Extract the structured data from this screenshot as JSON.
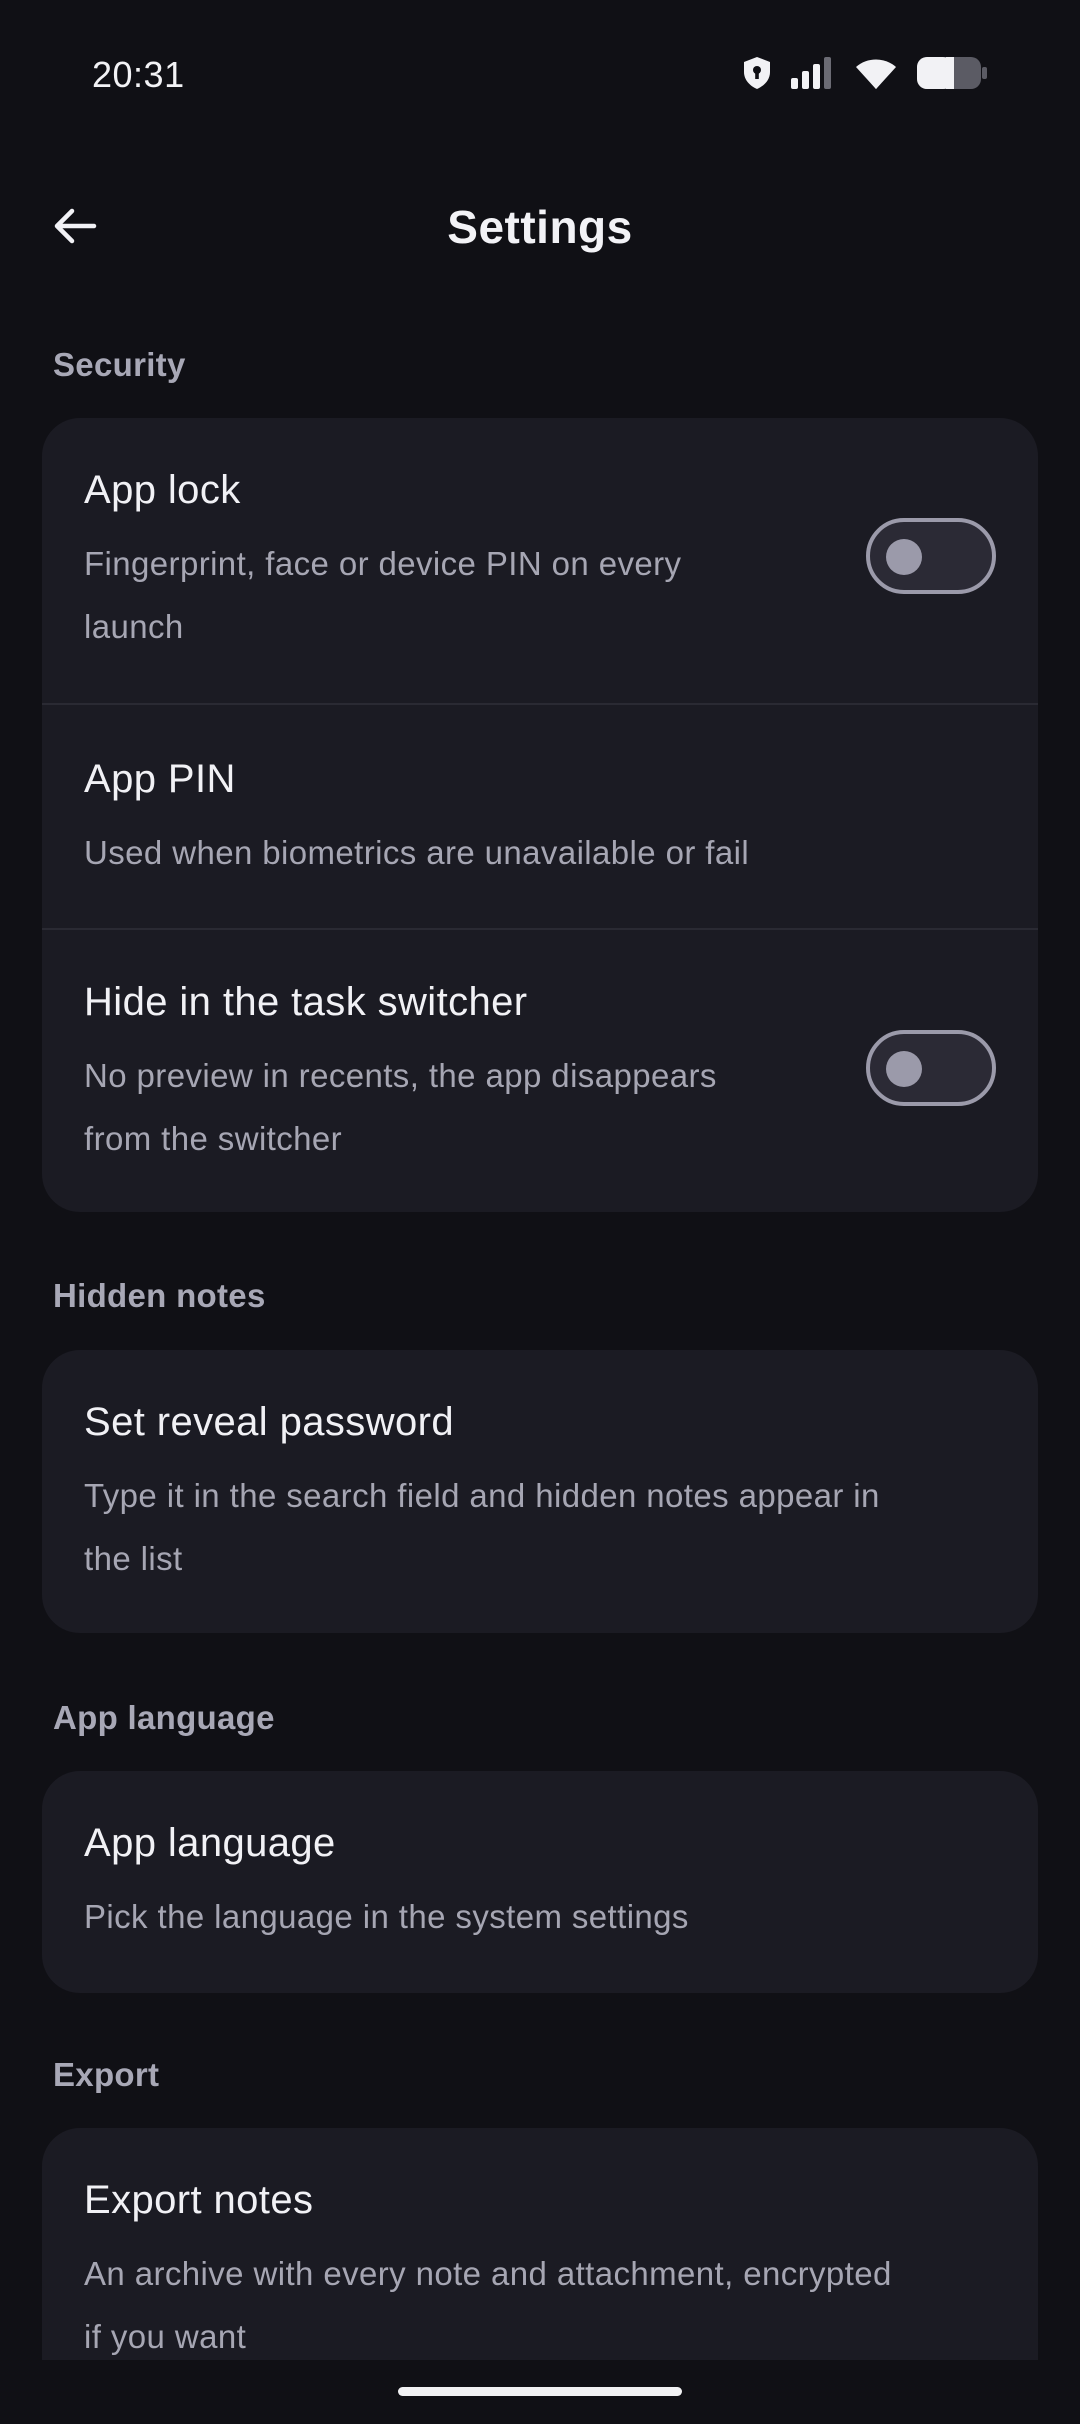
{
  "status_bar": {
    "time": "20:31",
    "icons": [
      "shield-lock-icon",
      "signal-icon",
      "wifi-icon",
      "battery-icon"
    ]
  },
  "app_bar": {
    "back_icon": "arrow-left-icon",
    "title": "Settings"
  },
  "sections": {
    "security": {
      "header": "Security",
      "app_lock": {
        "title": "App lock",
        "subtitle_line1": "Fingerprint, face or device PIN on every",
        "subtitle_line2": "launch",
        "enabled": false
      },
      "app_pin": {
        "title": "App PIN",
        "subtitle": "Used when biometrics are unavailable or fail"
      },
      "hide_switcher": {
        "title": "Hide in the task switcher",
        "subtitle_line1": "No preview in recents, the app disappears",
        "subtitle_line2": "from the switcher",
        "enabled": false
      }
    },
    "hidden_notes": {
      "header": "Hidden notes",
      "reveal_password": {
        "title": "Set reveal password",
        "subtitle_line1": "Type it in the search field and hidden notes appear in",
        "subtitle_line2": "the list"
      }
    },
    "app_language": {
      "header": "App language",
      "language": {
        "title": "App language",
        "subtitle": "Pick the language in the system settings"
      }
    },
    "export": {
      "header": "Export",
      "export_notes": {
        "title": "Export notes",
        "subtitle_line1": "An archive with every note and attachment, encrypted",
        "subtitle_line2": "if you want"
      }
    }
  },
  "colors": {
    "background": "#101015",
    "card": "#1b1b23",
    "section_header": "#a8a8b6",
    "subtitle": "#a6a6b3",
    "toggle_off": "#9b9aaa"
  }
}
